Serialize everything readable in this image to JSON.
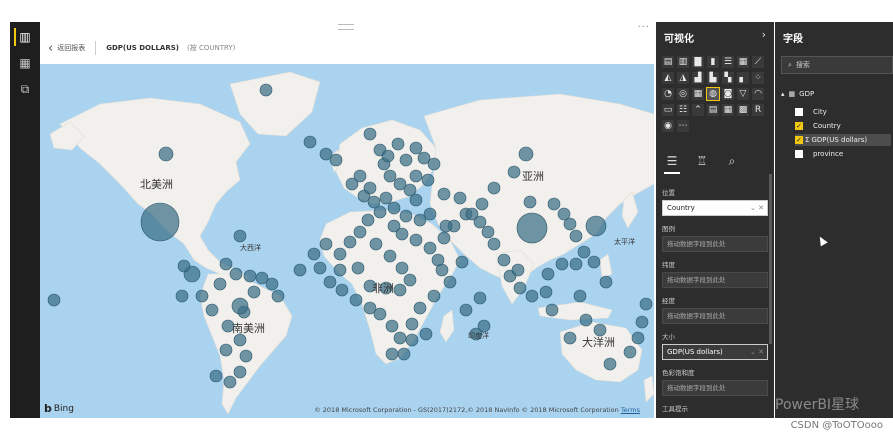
{
  "header": {
    "back_label": "返回报表",
    "visual_title": "GDP(US DOLLARS)",
    "visual_subtitle": "(按 COUNTRY)"
  },
  "map": {
    "labels": {
      "north_america": "北美洲",
      "south_america": "南美洲",
      "africa": "非洲",
      "asia": "亚洲",
      "oceania": "大洋洲",
      "atlantic": "大西洋",
      "indian": "印度洋",
      "pacific": "太平洋"
    },
    "bing": "Bing",
    "copyright": "© 2018 Microsoft Corporation - GS(2017)2172,© 2018 NavInfo © 2018 Microsoft Corporation",
    "terms": "Terms",
    "bubble_color": "#3a6f86"
  },
  "viz_pane": {
    "title": "可视化",
    "icons": [
      "stacked-bar",
      "clustered-bar",
      "stacked-column",
      "clustered-column",
      "100-bar",
      "100-column",
      "line-chart",
      "area-chart",
      "stacked-area",
      "line-column",
      "line-clustered",
      "ribbon",
      "waterfall",
      "scatter",
      "pie",
      "donut",
      "treemap",
      "map",
      "filled-map",
      "funnel",
      "gauge",
      "card",
      "multi-row-card",
      "kpi",
      "slicer",
      "table",
      "matrix",
      "r-visual",
      "globe",
      "more"
    ],
    "wells": [
      {
        "label": "位置",
        "field": "Country"
      },
      {
        "label": "图例",
        "placeholder": "拖动数据字段到此处"
      },
      {
        "label": "纬度",
        "placeholder": "拖动数据字段到此处"
      },
      {
        "label": "经度",
        "placeholder": "拖动数据字段到此处"
      },
      {
        "label": "大小",
        "field": "GDP(US dollars)"
      },
      {
        "label": "色彩饱和度",
        "placeholder": "拖动数据字段到此处"
      },
      {
        "label": "工具提示"
      }
    ]
  },
  "fields_pane": {
    "title": "字段",
    "search_placeholder": "搜索",
    "table_name": "GDP",
    "fields": [
      {
        "name": "City",
        "checked": false
      },
      {
        "name": "Country",
        "checked": true
      },
      {
        "name": "GDP(US dollars)",
        "checked": true,
        "sigma": "Σ"
      },
      {
        "name": "province",
        "checked": false
      }
    ]
  },
  "watermark": "PowerBI星球",
  "csdn": "CSDN @ToOTOooo",
  "accent": "#f2c811"
}
